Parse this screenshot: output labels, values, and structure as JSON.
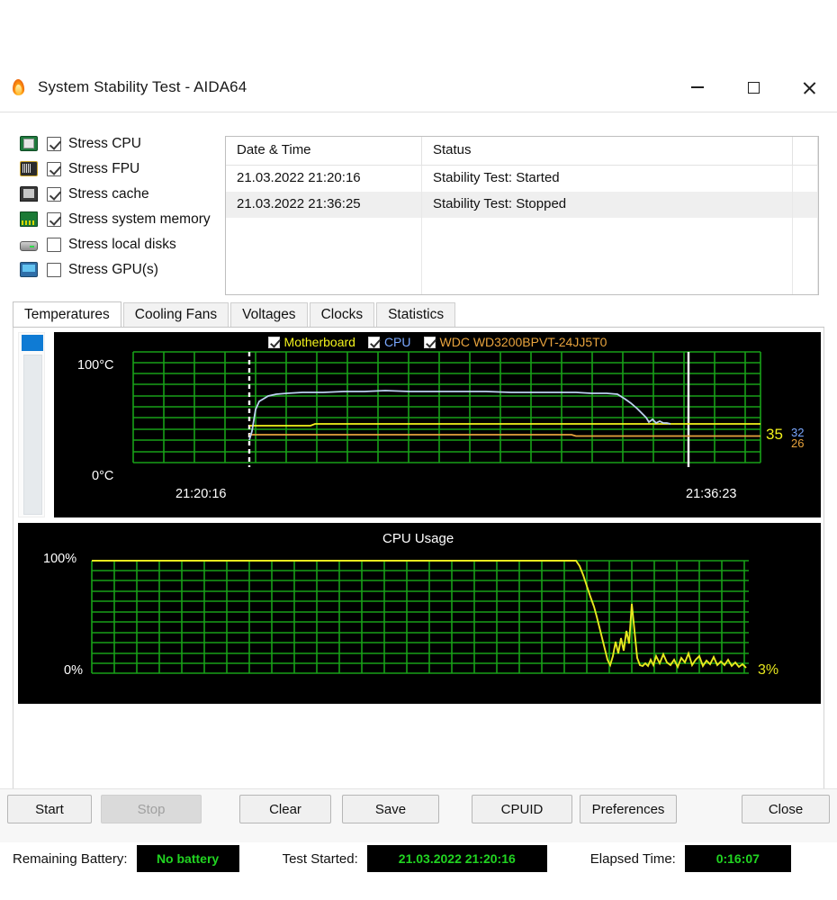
{
  "window": {
    "title": "System Stability Test - AIDA64",
    "icon": "flame-icon",
    "minimize_label": "─",
    "maximize_label": "□",
    "close_label": "✕"
  },
  "stress_options": [
    {
      "label": "Stress CPU",
      "checked": true,
      "icon": "cpu-chip-icon"
    },
    {
      "label": "Stress FPU",
      "checked": true,
      "icon": "fpu-chip-icon"
    },
    {
      "label": "Stress cache",
      "checked": true,
      "icon": "cache-module-icon"
    },
    {
      "label": "Stress system memory",
      "checked": true,
      "icon": "memory-module-icon"
    },
    {
      "label": "Stress local disks",
      "checked": false,
      "icon": "hard-disk-icon"
    },
    {
      "label": "Stress GPU(s)",
      "checked": false,
      "icon": "gpu-card-icon"
    }
  ],
  "log": {
    "columns": [
      "Date & Time",
      "Status"
    ],
    "rows": [
      {
        "datetime": "21.03.2022 21:20:16",
        "status": "Stability Test: Started"
      },
      {
        "datetime": "21.03.2022 21:36:25",
        "status": "Stability Test: Stopped"
      }
    ],
    "empty_rows": 3
  },
  "tabs": [
    {
      "label": "Temperatures",
      "active": true
    },
    {
      "label": "Cooling Fans",
      "active": false
    },
    {
      "label": "Voltages",
      "active": false
    },
    {
      "label": "Clocks",
      "active": false
    },
    {
      "label": "Statistics",
      "active": false
    }
  ],
  "colors": {
    "motherboard": "#f2f21c",
    "cpu": "#7aa8ff",
    "hdd": "#e8a33d",
    "grid": "#18a018",
    "cpu_usage_line": "#e8e81e",
    "chart_bg": "#000000",
    "axis_text": "#ffffff",
    "status_value": "#21d421",
    "scroll_thumb": "#0f7bd4"
  },
  "chart_data": [
    {
      "type": "line",
      "name": "temperatures",
      "title": "",
      "xlabel": "",
      "ylabel": "",
      "ylim": [
        0,
        100
      ],
      "y_tick_labels": [
        "100°C",
        "0°C"
      ],
      "x_tick_labels": [
        "21:20:16",
        "21:36:23"
      ],
      "grid": true,
      "legend_position": "top-center",
      "legend": [
        {
          "label": "Motherboard",
          "color": "#f2f21c",
          "checked": true
        },
        {
          "label": "CPU",
          "color": "#7aa8ff",
          "checked": true
        },
        {
          "label": "WDC WD3200BPVT-24JJ5T0",
          "color": "#e8a33d",
          "checked": true
        }
      ],
      "end_values": [
        {
          "label": "35",
          "color": "#f2f21c",
          "series": "Motherboard"
        },
        {
          "label": "32",
          "color": "#7aa8ff",
          "series": "CPU"
        },
        {
          "label": "26",
          "color": "#e8a33d",
          "series": "WDC WD3200BPVT-24JJ5T0"
        }
      ],
      "markers": {
        "test_start_dashed_x_pct": 18.5,
        "test_end_solid_x_pct": 88.5
      },
      "series": [
        {
          "name": "CPU",
          "color": "#7aa8ff",
          "x_pct": [
            0,
            18.3,
            18.5,
            19.0,
            19.6,
            20.4,
            21.4,
            23.0,
            25.0,
            28.0,
            32.0,
            36.0,
            40.0,
            45.0,
            50.0,
            55.0,
            60.0,
            65.0,
            70.0,
            75.0,
            78.0,
            81.0,
            83.0,
            84.5,
            85.5,
            86.3,
            87.0,
            87.6,
            88.2,
            88.6,
            89.2,
            89.8,
            90.4,
            91.0,
            91.6,
            92.3
          ],
          "values": [
            20,
            20,
            29,
            48,
            56,
            58,
            60,
            61,
            62,
            63,
            63,
            63,
            64,
            64,
            63,
            63,
            63,
            62,
            62,
            62,
            62,
            61,
            61,
            60,
            55,
            49,
            44,
            40,
            37,
            34,
            36,
            33,
            35,
            33,
            33,
            32
          ]
        },
        {
          "name": "Motherboard",
          "color": "#f2f21c",
          "x_pct": [
            18.5,
            19.0,
            28.0,
            28.5,
            60.0,
            85.0,
            92.3
          ],
          "values": [
            33,
            33,
            33,
            35,
            35,
            35,
            35
          ]
        },
        {
          "name": "WDC WD3200BPVT-24JJ5T0",
          "color": "#e8a33d",
          "x_pct": [
            18.5,
            19.0,
            63.0,
            63.5,
            92.3
          ],
          "values": [
            25,
            25,
            25,
            26,
            26
          ]
        }
      ]
    },
    {
      "type": "line",
      "name": "cpu-usage",
      "title": "CPU Usage",
      "xlabel": "",
      "ylabel": "",
      "ylim": [
        0,
        100
      ],
      "y_tick_labels": [
        "100%",
        "0%"
      ],
      "grid": true,
      "end_value": {
        "label": "3%",
        "color": "#e8e81e"
      },
      "series": [
        {
          "name": "CPU Usage",
          "color": "#e8e81e",
          "x_pct": [
            0,
            10,
            20,
            30,
            40,
            50,
            60,
            70,
            76.0,
            76.6,
            77.2,
            77.8,
            78.4,
            79.0,
            79.5,
            80.0,
            80.5,
            81.0,
            81.5,
            82.0,
            82.4,
            82.8,
            83.2,
            83.6,
            84.0,
            84.4,
            84.8,
            85.2,
            85.6,
            86.0,
            86.4,
            86.8,
            87.2,
            87.6,
            88.0,
            88.6,
            89.2,
            89.8,
            90.4,
            91.0,
            91.6,
            92.2,
            92.8,
            93.4,
            94.0,
            94.6,
            95.2,
            95.8,
            96.4,
            97.0
          ],
          "values": [
            100,
            100,
            100,
            100,
            100,
            100,
            100,
            100,
            100,
            92,
            78,
            64,
            52,
            42,
            33,
            20,
            10,
            6,
            18,
            33,
            20,
            35,
            22,
            40,
            28,
            62,
            40,
            14,
            5,
            4,
            6,
            4,
            9,
            5,
            11,
            6,
            12,
            7,
            5,
            9,
            4,
            8,
            12,
            6,
            4,
            8,
            5,
            9,
            5,
            3
          ]
        }
      ]
    }
  ],
  "status": {
    "battery_label": "Remaining Battery:",
    "battery_value": "No battery",
    "started_label": "Test Started:",
    "started_value": "21.03.2022 21:20:16",
    "elapsed_label": "Elapsed Time:",
    "elapsed_value": "0:16:07"
  },
  "buttons": [
    {
      "label": "Start",
      "disabled": false
    },
    {
      "label": "Stop",
      "disabled": true
    },
    {
      "label": "Clear",
      "disabled": false
    },
    {
      "label": "Save",
      "disabled": false
    },
    {
      "label": "CPUID",
      "disabled": false
    },
    {
      "label": "Preferences",
      "disabled": false
    },
    {
      "label": "Close",
      "disabled": false
    }
  ]
}
